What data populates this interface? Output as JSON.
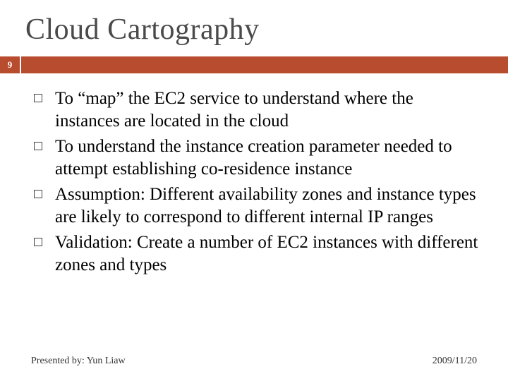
{
  "title": "Cloud Cartography",
  "page_number": "9",
  "bullets": [
    "To “map” the EC2 service to understand where the instances are located in the cloud",
    "To understand the instance creation parameter needed to attempt establishing co-residence instance",
    "Assumption: Different availability zones and instance types are likely to correspond to different internal IP ranges",
    "Validation: Create a number of EC2 instances with different zones and types"
  ],
  "footer": {
    "presenter": "Presented by: Yun Liaw",
    "date": "2009/11/20"
  }
}
